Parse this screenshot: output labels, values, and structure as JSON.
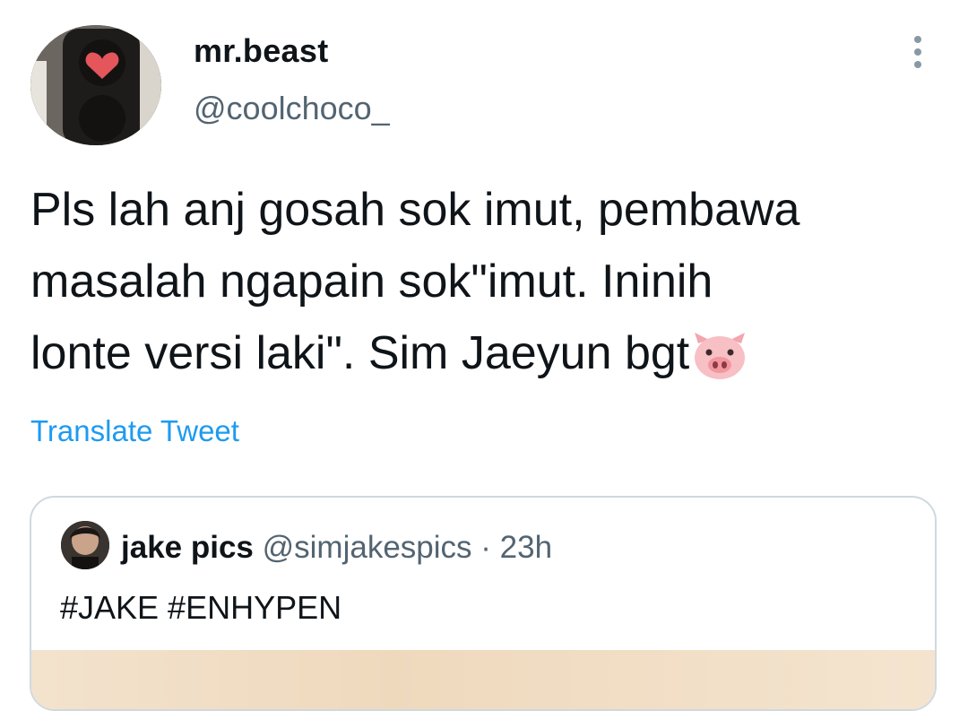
{
  "author": {
    "name": "mr.beast",
    "handle": "@coolchoco_",
    "avatar_icon": "traffic-light-heart-avatar"
  },
  "tweet": {
    "text_line1": "Pls lah anj gosah sok imut, pembawa",
    "text_line2": "masalah ngapain sok\"imut. Ininih",
    "text_line3": "lonte versi laki\". Sim Jaeyun bgt",
    "emoji": "pig-face-emoji",
    "translate_label": "Translate Tweet"
  },
  "quoted_tweet": {
    "name": "jake pics",
    "handle": "@simjakespics",
    "separator": "·",
    "time": "23h",
    "text": "#JAKE #ENHYPEN"
  },
  "colors": {
    "accent": "#1d9bf0",
    "secondary_text": "#536471",
    "border": "#cfd9de"
  },
  "icons": {
    "more": "more-vertical-icon"
  }
}
